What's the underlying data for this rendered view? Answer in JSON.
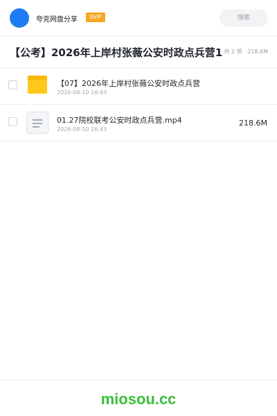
{
  "header": {
    "app_name": "夸克网盘分享",
    "vip_badge": "SVIP",
    "search_label": "搜索",
    "avatar_color": "#1f7bf2",
    "vip_color": "#f5a623"
  },
  "folder": {
    "title": "【公考】2026年上岸村张薇公安时政点兵营1",
    "summary": "共 2 项 · 218.6M"
  },
  "files": [
    {
      "name": "【07】2026年上岸村张薇公安时政点兵营",
      "date": "2026-08-10 16:43",
      "size": "",
      "icon": "folder-icon"
    },
    {
      "name": "01.27院校联考公安时政点兵营.mp4",
      "date": "2026-08-10 16:43",
      "size": "218.6M",
      "icon": "document-icon"
    }
  ],
  "footer": {
    "brand": "miosou.cc",
    "brand_color": "#3bbf3b"
  }
}
